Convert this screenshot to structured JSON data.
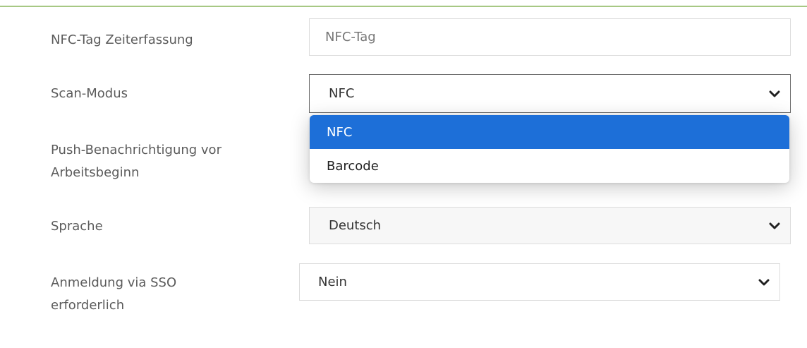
{
  "colors": {
    "accent_rule": "#a7c884",
    "highlight": "#1d6fd8"
  },
  "form": {
    "nfc_tag": {
      "label": "NFC-Tag Zeiterfassung",
      "placeholder": "NFC-Tag"
    },
    "scan_mode": {
      "label": "Scan-Modus",
      "value": "NFC",
      "options": [
        "NFC",
        "Barcode"
      ],
      "highlighted_option": "NFC"
    },
    "push": {
      "label_line1": "Push-Benachrichtigung vor",
      "label_line2": "Arbeitsbeginn"
    },
    "language": {
      "label": "Sprache",
      "value": "Deutsch"
    },
    "sso": {
      "label_line1": "Anmeldung via SSO",
      "label_line2": "erforderlich",
      "value": "Nein"
    }
  },
  "icons": {
    "select_arrow": "chevron-down-icon"
  }
}
